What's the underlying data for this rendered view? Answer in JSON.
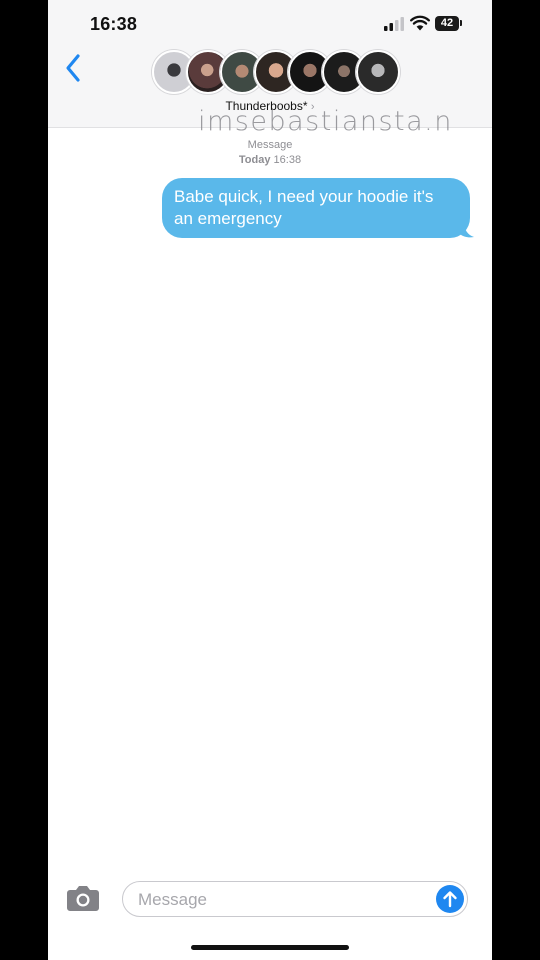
{
  "status_bar": {
    "time": "16:38",
    "battery": "42",
    "icons": [
      "signal-icon",
      "wifi-icon",
      "battery-icon"
    ]
  },
  "header": {
    "back_icon": "chevron-left-icon",
    "group_name": "Thunderboobs*",
    "group_chevron": "›",
    "avatar_count": 7
  },
  "watermark": "imsebastiansta.n",
  "conversation": {
    "service_label": "Message",
    "date_label": "Today",
    "time_label": "16:38",
    "messages": [
      {
        "direction": "outgoing",
        "line1": "Babe quick, I need your hoodie it's",
        "line2": "an emergency"
      }
    ]
  },
  "composer": {
    "camera_icon": "camera-icon",
    "placeholder": "Message",
    "send_icon": "arrow-up-icon"
  },
  "colors": {
    "bubble": "#5ab8ea",
    "accent": "#1f87f0",
    "header_bg": "#f6f6f7"
  }
}
